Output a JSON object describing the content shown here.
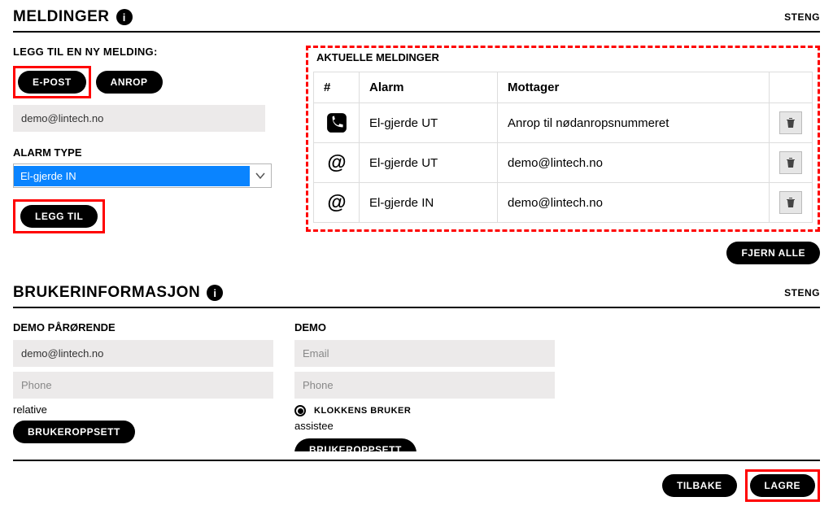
{
  "section1": {
    "title": "MELDINGER",
    "close": "STENG",
    "add_label": "LEGG TIL EN NY MELDING:",
    "tab_epost": "E-POST",
    "tab_anrop": "ANROP",
    "email_value": "demo@lintech.no",
    "alarm_type_label": "ALARM TYPE",
    "alarm_type_value": "El-gjerde IN",
    "add_button": "LEGG TIL"
  },
  "aktuelle": {
    "title": "AKTUELLE MELDINGER",
    "col_hash": "#",
    "col_alarm": "Alarm",
    "col_mottager": "Mottager",
    "rows": [
      {
        "icon": "phone",
        "alarm": "El-gjerde UT",
        "mottager": "Anrop til nødanropsnummeret"
      },
      {
        "icon": "at",
        "alarm": "El-gjerde UT",
        "mottager": "demo@lintech.no"
      },
      {
        "icon": "at",
        "alarm": "El-gjerde IN",
        "mottager": "demo@lintech.no"
      }
    ],
    "fjern_alle": "FJERN ALLE"
  },
  "section2": {
    "title": "BRUKERINFORMASJON",
    "close": "STENG"
  },
  "user1": {
    "name": "DEMO PÅRØRENDE",
    "email": "demo@lintech.no",
    "phone_placeholder": "Phone",
    "role": "relative",
    "oppsett": "BRUKEROPPSETT"
  },
  "user2": {
    "name": "DEMO",
    "email_placeholder": "Email",
    "phone_placeholder": "Phone",
    "radio_label": "KLOKKENS BRUKER",
    "role": "assistee",
    "oppsett": "BRUKEROPPSETT"
  },
  "footer": {
    "tilbake": "TILBAKE",
    "lagre": "LAGRE"
  }
}
